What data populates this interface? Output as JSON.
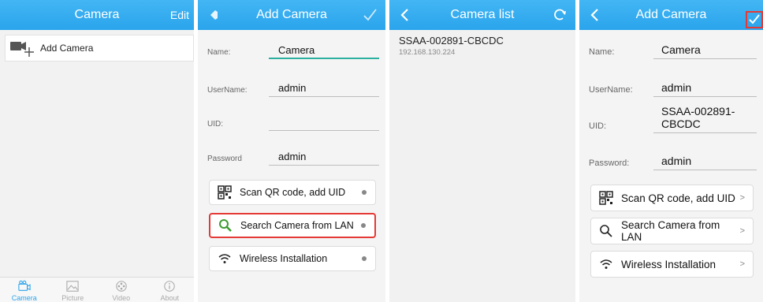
{
  "panel_camera": {
    "title": "Camera",
    "edit_label": "Edit",
    "add_camera_label": "Add Camera",
    "tabs": [
      {
        "label": "Camera",
        "icon": "camera-icon"
      },
      {
        "label": "Picture",
        "icon": "picture-icon"
      },
      {
        "label": "Video",
        "icon": "video-icon"
      },
      {
        "label": "About",
        "icon": "info-icon"
      }
    ]
  },
  "panel_add1": {
    "title": "Add Camera",
    "fields": [
      {
        "label": "Name:",
        "value": "Camera"
      },
      {
        "label": "UserName:",
        "value": "admin"
      },
      {
        "label": "UID:",
        "value": ""
      },
      {
        "label": "Password",
        "value": "admin"
      }
    ],
    "buttons": [
      {
        "label": "Scan QR code, add UID",
        "icon": "qr-code-icon"
      },
      {
        "label": "Search Camera from LAN",
        "icon": "search-icon"
      },
      {
        "label": "Wireless Installation",
        "icon": "wifi-icon"
      }
    ]
  },
  "panel_list": {
    "title": "Camera list",
    "devices": [
      {
        "uid": "SSAA-002891-CBCDC",
        "ip": "192.168.130.224"
      }
    ]
  },
  "panel_add2": {
    "title": "Add Camera",
    "fields": [
      {
        "label": "Name:",
        "value": "Camera"
      },
      {
        "label": "UserName:",
        "value": "admin"
      },
      {
        "label": "UID:",
        "value": "SSAA-002891-CBCDC"
      },
      {
        "label": "Password:",
        "value": "admin"
      }
    ],
    "buttons": [
      {
        "label": "Scan QR code, add UID",
        "icon": "qr-code-icon",
        "chevron": ">"
      },
      {
        "label": "Search Camera from LAN",
        "icon": "search-icon",
        "chevron": ">"
      },
      {
        "label": "Wireless Installation",
        "icon": "wifi-icon",
        "chevron": ">"
      }
    ]
  },
  "colors": {
    "header": "#2aa4ec",
    "focus_line": "#2bb09f",
    "highlight": "#e53935",
    "search_icon": "#3c9a2e"
  }
}
